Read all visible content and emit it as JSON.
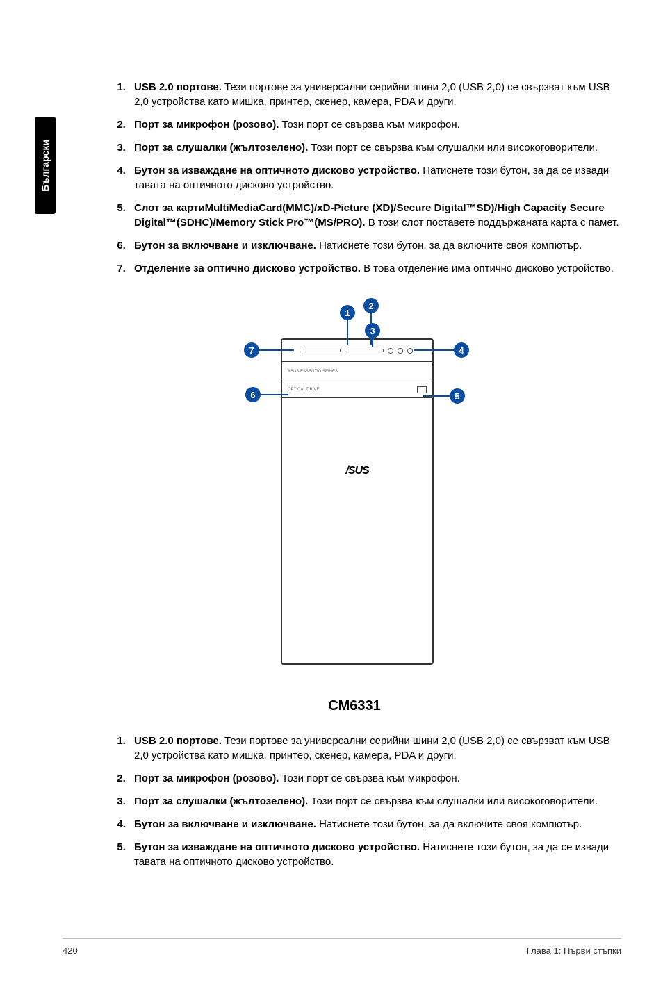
{
  "sidebar": {
    "language": "Български"
  },
  "list1": {
    "items": [
      {
        "bold": "USB 2.0 портове.",
        "text": " Тези портове за универсални серийни шини 2,0 (USB 2,0) се свързват към USB 2,0 устройства като мишка, принтер, скенер, камера, PDA и други."
      },
      {
        "bold": "Порт за микрофон (розово).",
        "text": " Този порт се свързва към микрофон."
      },
      {
        "bold": "Порт за слушалки (жълтозелено).",
        "text": " Този порт се свързва към слушалки или високоговорители."
      },
      {
        "bold": "Бутон за изваждане на оптичното дисково устройство.",
        "text": " Натиснете този бутон, за да се извади тавата на оптичното дисково устройство."
      },
      {
        "bold": "Слот за картиMultiMediaCard(MMC)/xD-Picture (XD)/Secure Digital™SD)/High Capacity Secure Digital™(SDHC)/Memory Stick Pro™(MS/PRO).",
        "text": " В този слот поставете поддържаната карта с памет."
      },
      {
        "bold": "Бутон за включване и изключване.",
        "text": " Натиснете този бутон, за да включите своя компютър."
      },
      {
        "bold": "Отделение за оптично дисково устройство.",
        "text": " В това отделение има оптично дисково устройство."
      }
    ]
  },
  "figure": {
    "model": "CM6331",
    "logo": "/SUS"
  },
  "list2": {
    "items": [
      {
        "bold": "USB 2.0 портове.",
        "text": " Тези портове за универсални серийни шини 2,0 (USB 2,0) се свързват към USB 2,0 устройства като мишка, принтер, скенер, камера, PDA и други."
      },
      {
        "bold": "Порт за микрофон (розово).",
        "text": " Този порт се свързва към микрофон."
      },
      {
        "bold": "Порт за слушалки (жълтозелено).",
        "text": " Този порт се свързва към слушалки или високоговорители."
      },
      {
        "bold": "Бутон за включване и изключване.",
        "text": " Натиснете този бутон, за да включите своя компютър."
      },
      {
        "bold": "Бутон за изваждане на оптичното дисково устройство.",
        "text": " Натиснете този бутон, за да се извади тавата на оптичното дисково устройство."
      }
    ]
  },
  "footer": {
    "page": "420",
    "chapter": "Глава 1: Първи стъпки"
  }
}
